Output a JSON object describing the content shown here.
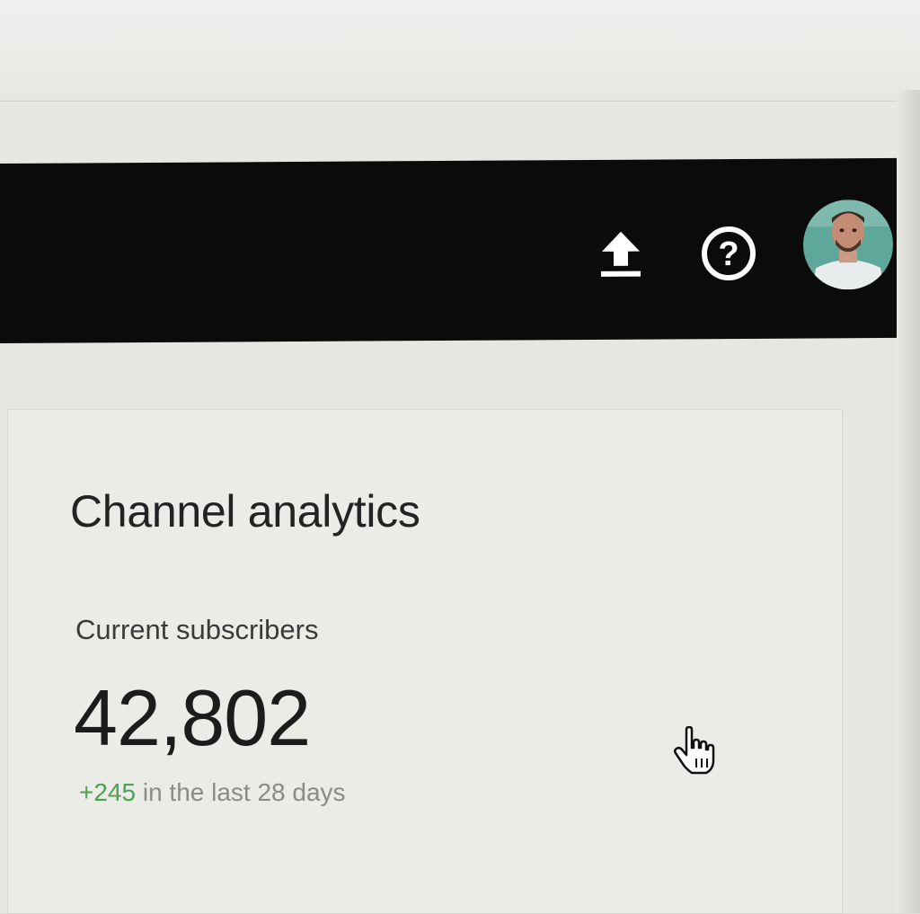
{
  "header": {
    "actions": [
      {
        "icon": "upload-icon"
      },
      {
        "icon": "help-icon",
        "glyph": "?"
      },
      {
        "icon": "avatar"
      }
    ],
    "background_color": "#0b0b0c",
    "icon_color": "#ffffff"
  },
  "card": {
    "title": "Channel analytics",
    "subscribers": {
      "label": "Current subscribers",
      "value": "42,802",
      "delta": "+245",
      "delta_suffix": " in the last 28 days",
      "delta_color": "#4fa24f"
    }
  },
  "cursor": {
    "icon": "hand-pointer-icon"
  }
}
